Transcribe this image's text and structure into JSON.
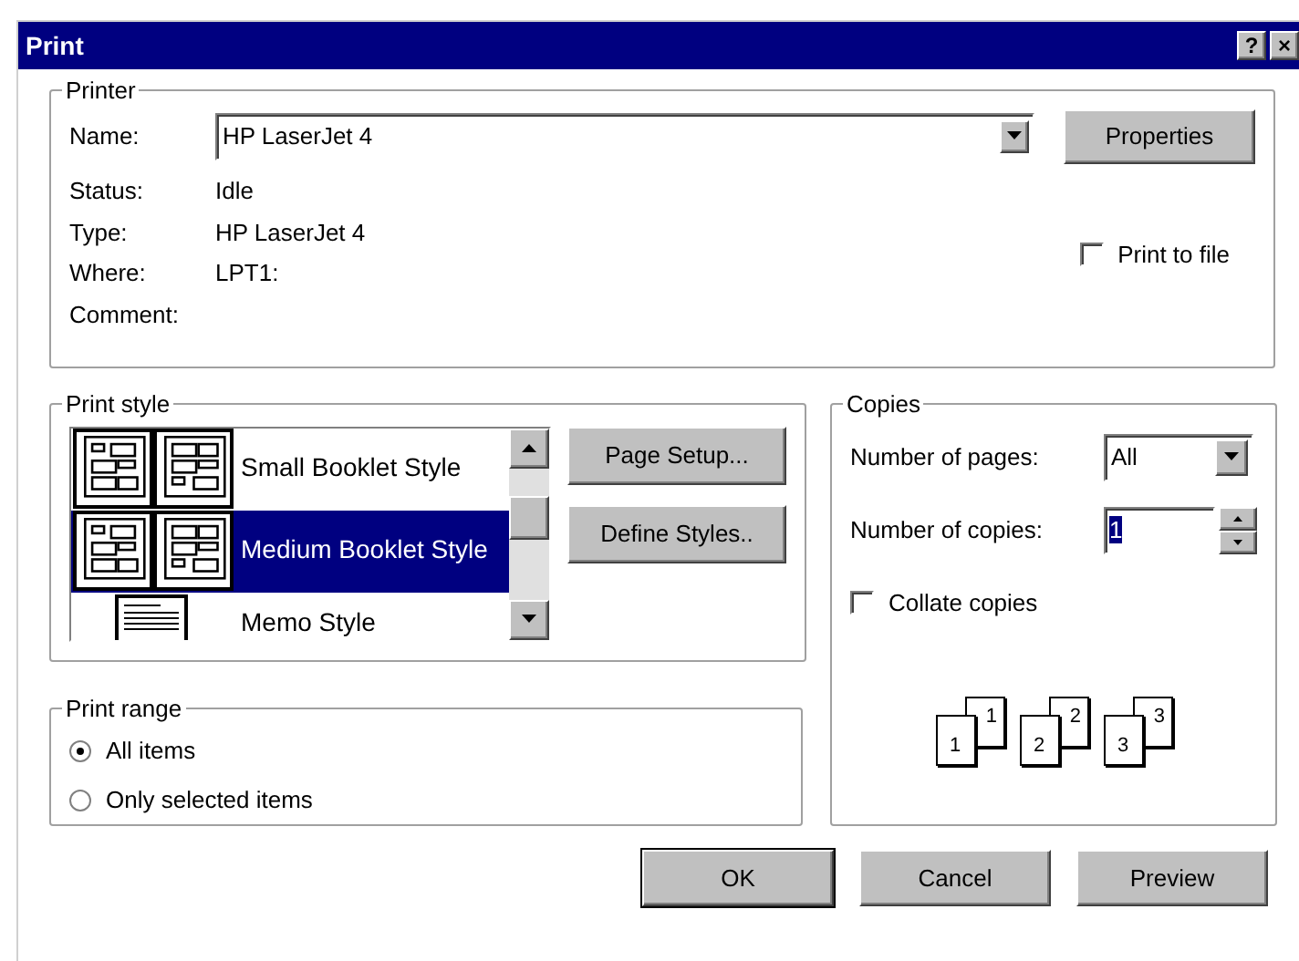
{
  "window": {
    "title": "Print",
    "title_buttons": [
      "?",
      "×"
    ]
  },
  "printer": {
    "legend": "Printer",
    "name_label": "Name:",
    "name_value": "HP LaserJet 4",
    "properties": {
      "label": "Properties"
    },
    "info": [
      {
        "label": "Status:",
        "value": "Idle"
      },
      {
        "label": "Type:",
        "value": "HP LaserJet 4"
      },
      {
        "label": "Where:",
        "value": "LPT1:"
      },
      {
        "label": "Comment:"
      }
    ],
    "print_to_file": {
      "label": "Print to file",
      "checked": false
    }
  },
  "print_style": {
    "legend": "Print style",
    "items": [
      {
        "label": "Small Booklet Style",
        "kind": "booklet",
        "selected": false
      },
      {
        "label": "Medium Booklet Style",
        "kind": "booklet",
        "selected": true
      },
      {
        "label": "Memo Style",
        "kind": "memo",
        "selected": false
      }
    ],
    "buttons": [
      {
        "label": "Page Setup..."
      },
      {
        "label": "Define Styles.."
      }
    ]
  },
  "print_range": {
    "legend": "Print range",
    "options": [
      {
        "label": "All items",
        "selected": true
      },
      {
        "label": "Only selected items",
        "selected": false
      }
    ]
  },
  "copies": {
    "legend": "Copies",
    "pages_label": "Number of pages:",
    "pages_value": "All",
    "copies_label": "Number of copies:",
    "copies_value": "1",
    "collate": {
      "label": "Collate copies",
      "checked": false
    },
    "collate_pages": [
      {
        "front": "1",
        "back": "1"
      },
      {
        "front": "2",
        "back": "2"
      },
      {
        "front": "3",
        "back": "3"
      }
    ]
  },
  "buttons": [
    {
      "label": "OK",
      "default": true
    },
    {
      "label": "Cancel",
      "default": false
    },
    {
      "label": "Preview",
      "default": false
    }
  ]
}
